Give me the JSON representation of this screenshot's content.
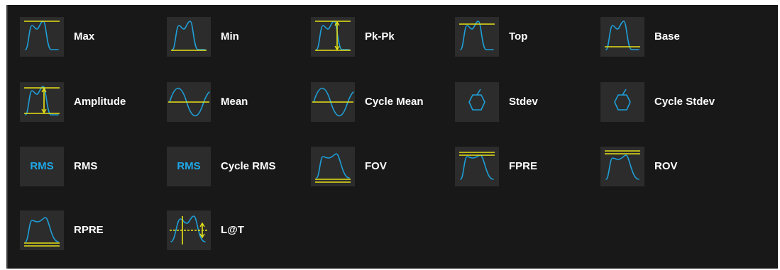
{
  "colors": {
    "wave": "#1e9fd8",
    "marker": "#e6e216",
    "tile": "#2c2c2c",
    "background": "#181818"
  },
  "measurements": [
    {
      "label": "Max",
      "icon": "max-icon"
    },
    {
      "label": "Min",
      "icon": "min-icon"
    },
    {
      "label": "Pk-Pk",
      "icon": "pk-pk-icon"
    },
    {
      "label": "Top",
      "icon": "top-icon"
    },
    {
      "label": "Base",
      "icon": "base-icon"
    },
    {
      "label": "Amplitude",
      "icon": "amplitude-icon"
    },
    {
      "label": "Mean",
      "icon": "mean-icon"
    },
    {
      "label": "Cycle Mean",
      "icon": "cycle-mean-icon"
    },
    {
      "label": "Stdev",
      "icon": "stdev-icon"
    },
    {
      "label": "Cycle Stdev",
      "icon": "cycle-stdev-icon"
    },
    {
      "label": "RMS",
      "icon": "rms-icon",
      "icon_text": "RMS"
    },
    {
      "label": "Cycle RMS",
      "icon": "cycle-rms-icon",
      "icon_text": "RMS"
    },
    {
      "label": "FOV",
      "icon": "fov-icon"
    },
    {
      "label": "FPRE",
      "icon": "fpre-icon"
    },
    {
      "label": "ROV",
      "icon": "rov-icon"
    },
    {
      "label": "RPRE",
      "icon": "rpre-icon"
    },
    {
      "label": "L@T",
      "icon": "level-at-time-icon"
    }
  ]
}
